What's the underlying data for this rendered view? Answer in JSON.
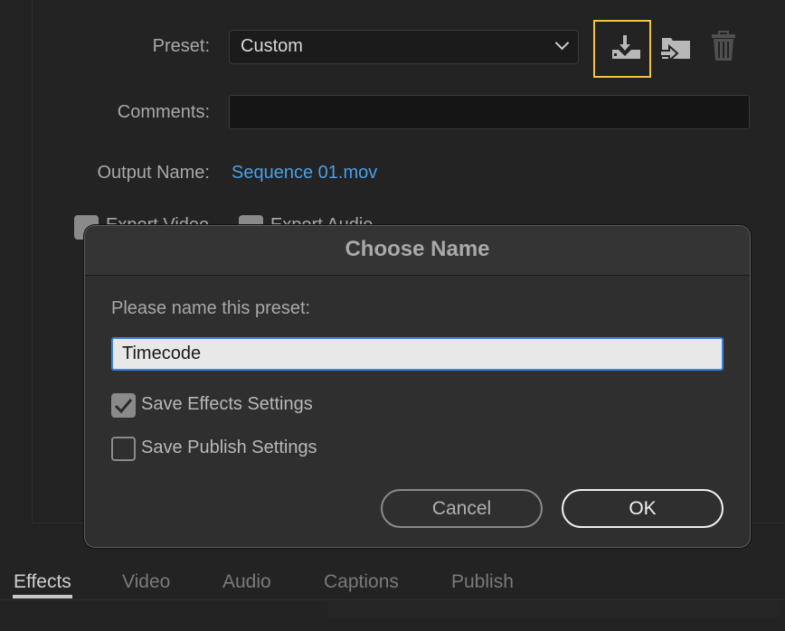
{
  "form": {
    "preset_label": "Preset:",
    "preset_value": "Custom",
    "comments_label": "Comments:",
    "comments_value": "",
    "output_name_label": "Output Name:",
    "output_name_value": "Sequence 01.mov",
    "export_video_label": "Export Video",
    "export_video_checked": true,
    "export_audio_label": "Export Audio",
    "export_audio_checked": true
  },
  "icons": {
    "save_preset": "save-preset-icon",
    "import_preset": "import-preset-icon",
    "delete_preset": "trash-icon",
    "focus_color": "#f5c343"
  },
  "dialog": {
    "title": "Choose Name",
    "prompt": "Please name this preset:",
    "name_value": "Timecode",
    "save_effects_label": "Save Effects Settings",
    "save_effects_checked": true,
    "save_publish_label": "Save Publish Settings",
    "save_publish_checked": false,
    "cancel_label": "Cancel",
    "ok_label": "OK"
  },
  "tabs": [
    {
      "label": "Effects",
      "active": true
    },
    {
      "label": "Video",
      "active": false
    },
    {
      "label": "Audio",
      "active": false
    },
    {
      "label": "Captions",
      "active": false
    },
    {
      "label": "Publish",
      "active": false
    }
  ]
}
